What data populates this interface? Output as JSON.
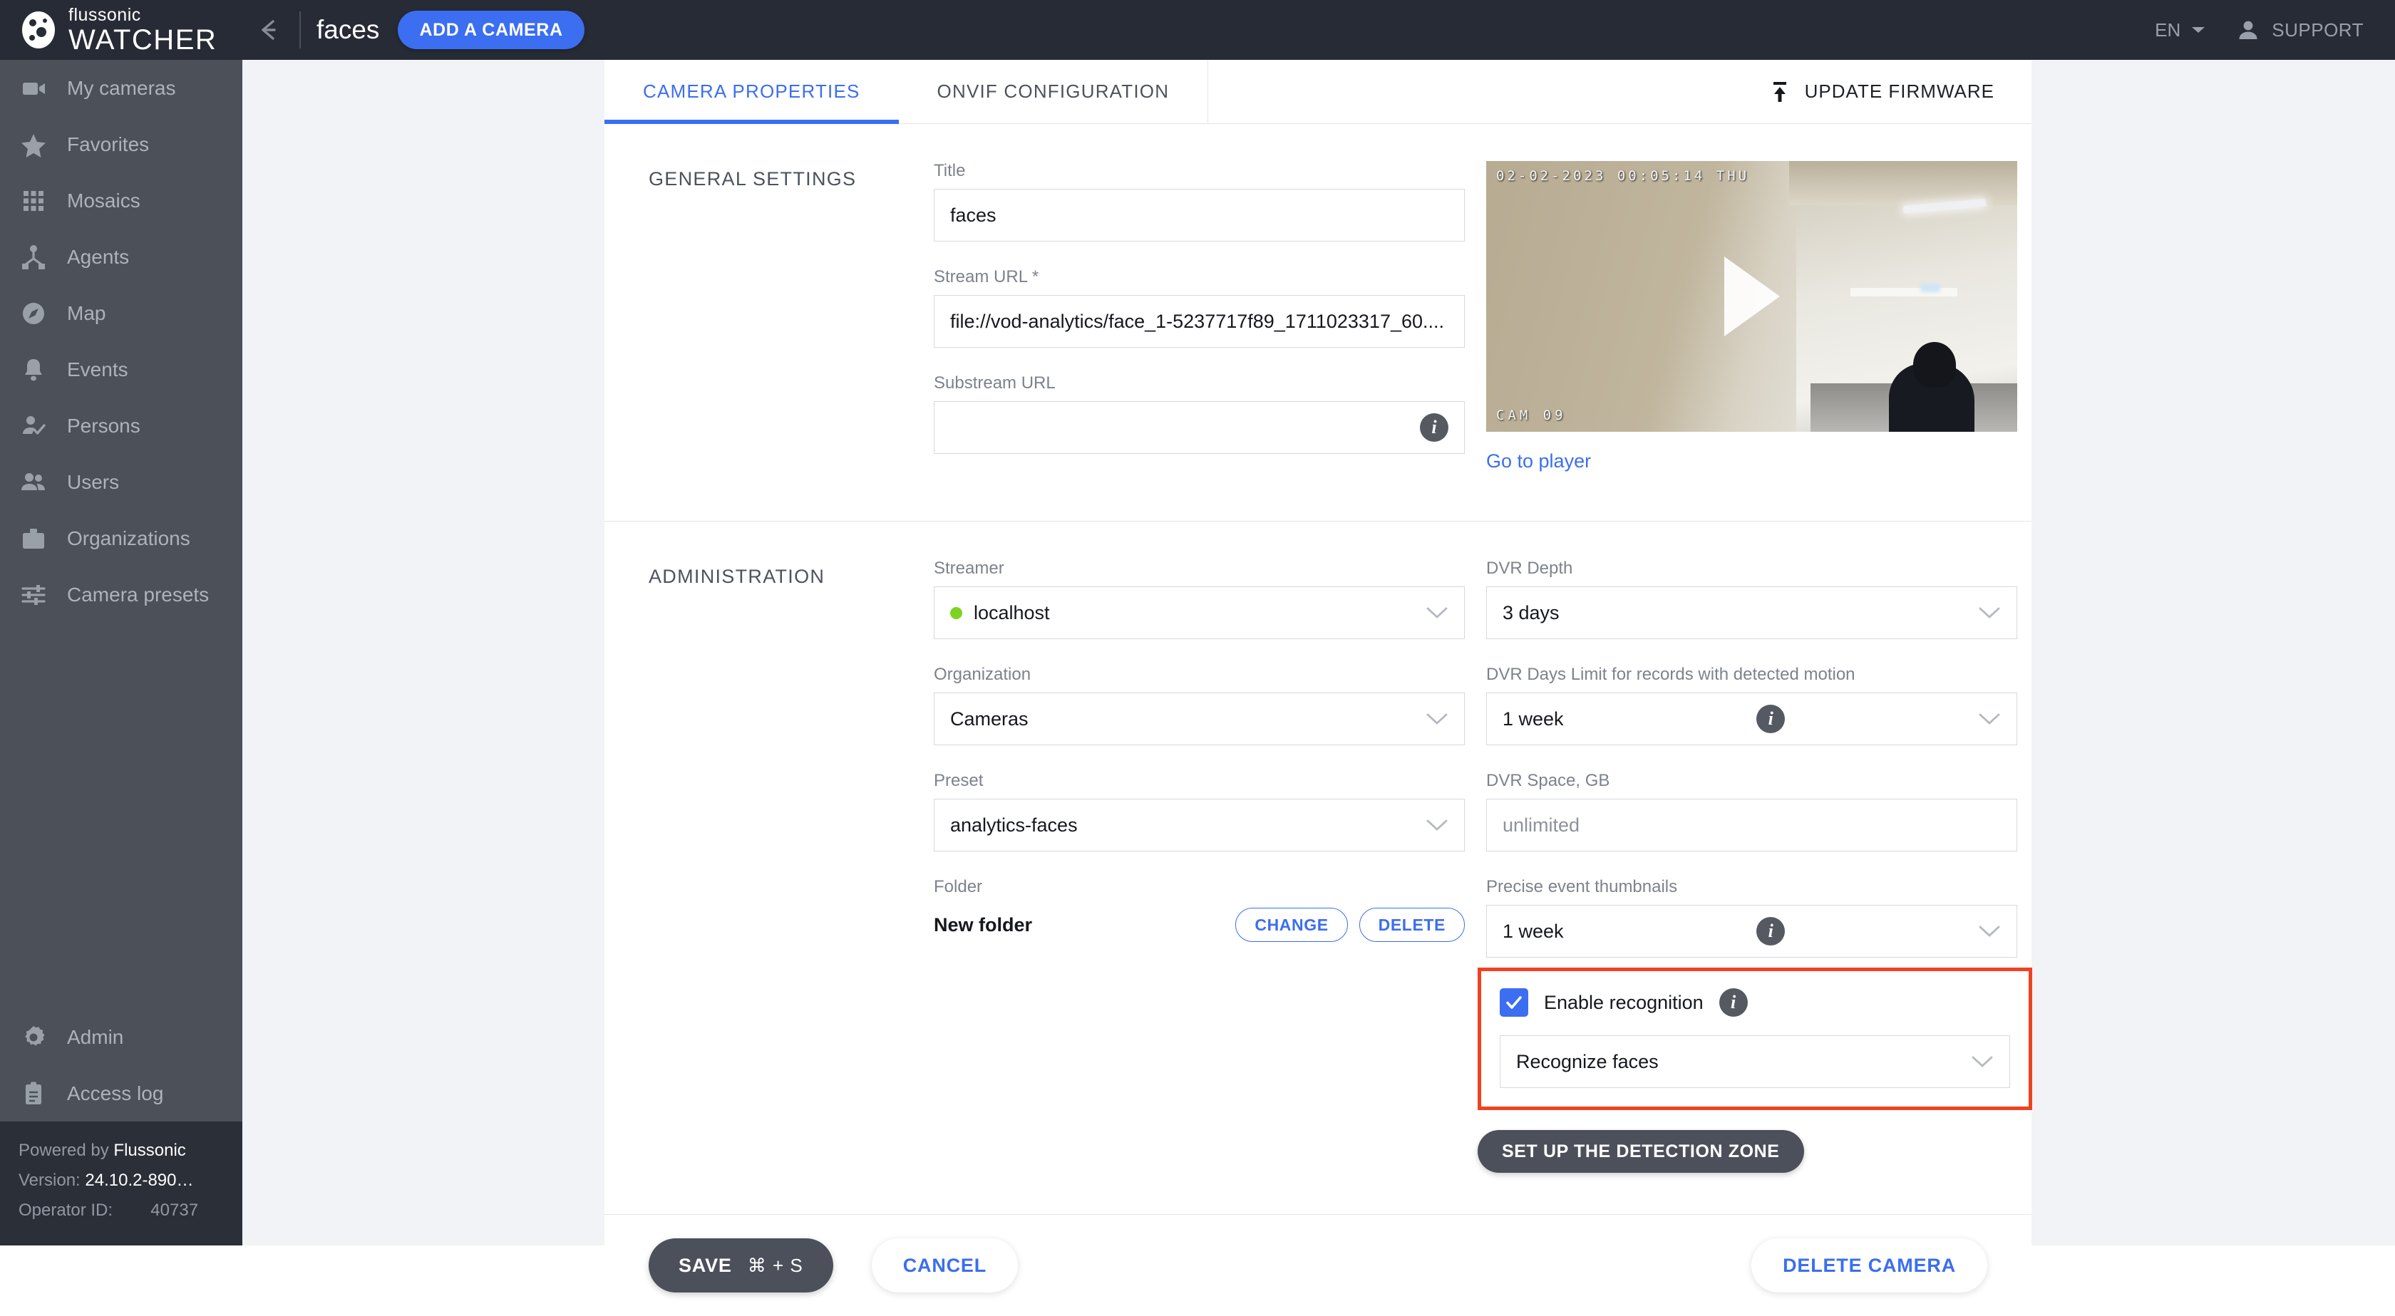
{
  "topbar": {
    "brand_top": "flussonic",
    "brand_bottom": "WATCHER",
    "back_icon": "arrow-left-icon",
    "page_title": "faces",
    "add_camera_label": "ADD A CAMERA",
    "language": "EN",
    "support_label": "SUPPORT"
  },
  "sidebar": {
    "items": [
      {
        "label": "My cameras",
        "icon": "video-camera-icon"
      },
      {
        "label": "Favorites",
        "icon": "star-icon"
      },
      {
        "label": "Mosaics",
        "icon": "grid-icon"
      },
      {
        "label": "Agents",
        "icon": "agent-node-icon"
      },
      {
        "label": "Map",
        "icon": "compass-icon"
      },
      {
        "label": "Events",
        "icon": "bell-icon"
      },
      {
        "label": "Persons",
        "icon": "person-check-icon"
      },
      {
        "label": "Users",
        "icon": "users-icon"
      },
      {
        "label": "Organizations",
        "icon": "briefcase-icon"
      },
      {
        "label": "Camera presets",
        "icon": "sliders-icon"
      }
    ],
    "bottom_items": [
      {
        "label": "Admin",
        "icon": "gear-icon"
      },
      {
        "label": "Access log",
        "icon": "clipboard-icon"
      }
    ],
    "footer": {
      "powered_prefix": "Powered by ",
      "powered_brand": "Flussonic",
      "version_label": "Version: ",
      "version_value": "24.10.2-890…",
      "operator_label": "Operator ID:",
      "operator_value": "40737"
    }
  },
  "tabs": [
    {
      "label": "CAMERA PROPERTIES",
      "active": true
    },
    {
      "label": "ONVIF CONFIGURATION",
      "active": false
    }
  ],
  "firmware": {
    "label": "UPDATE FIRMWARE",
    "icon": "upload-icon"
  },
  "general_settings": {
    "section_title": "GENERAL SETTINGS",
    "title_label": "Title",
    "title_value": "faces",
    "stream_url_label": "Stream URL *",
    "stream_url_value": "file://vod-analytics/face_1-5237717f89_1711023317_60....",
    "substream_url_label": "Substream URL",
    "substream_url_value": "",
    "substream_info_icon": "info-icon",
    "video": {
      "timestamp_overlay": "02-02-2023  00:05:14  THU",
      "camera_overlay": "CAM 09",
      "play_icon": "play-icon"
    },
    "go_to_player": "Go to player"
  },
  "administration": {
    "section_title": "ADMINISTRATION",
    "streamer_label": "Streamer",
    "streamer_value": "localhost",
    "streamer_status_color": "#7ed321",
    "organization_label": "Organization",
    "organization_value": "Cameras",
    "preset_label": "Preset",
    "preset_value": "analytics-faces",
    "folder_label": "Folder",
    "folder_value": "New folder",
    "folder_change_label": "CHANGE",
    "folder_delete_label": "DELETE",
    "dvr_depth_label": "DVR Depth",
    "dvr_depth_value": "3 days",
    "dvr_days_limit_label": "DVR Days Limit for records with detected motion",
    "dvr_days_limit_value": "1 week",
    "dvr_space_label": "DVR Space, GB",
    "dvr_space_value": "unlimited",
    "precise_thumbs_label": "Precise event thumbnails",
    "precise_thumbs_value": "1 week",
    "enable_recognition_label": "Enable recognition",
    "enable_recognition_checked": true,
    "recognition_mode_value": "Recognize faces",
    "detection_zone_label": "SET UP THE DETECTION ZONE",
    "highlight_color": "#ef4222"
  },
  "actions": {
    "save_label": "SAVE",
    "save_shortcut": "⌘ + S",
    "cancel_label": "CANCEL",
    "delete_camera_label": "DELETE CAMERA"
  },
  "colors": {
    "accent": "#3b6ef0",
    "dark": "#272b35",
    "sidebar": "#4b5059",
    "highlight": "#ef4222"
  }
}
